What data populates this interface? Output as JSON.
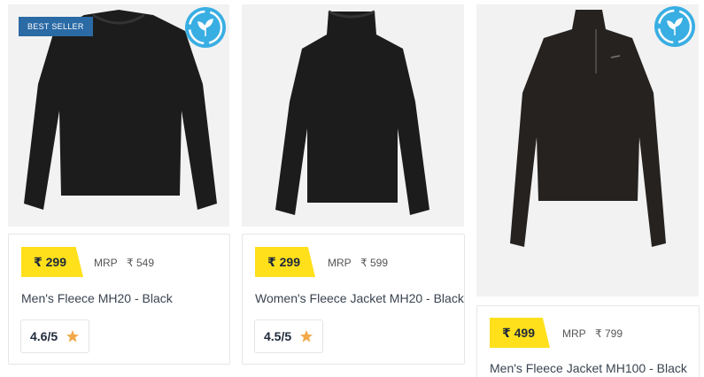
{
  "products": [
    {
      "badge": "BEST SELLER",
      "price": "₹ 299",
      "mrp_label": "MRP",
      "mrp_value": "₹ 549",
      "title": "Men's Fleece MH20 - Black",
      "rating": "4.6/5",
      "icons": [
        "eco-design-icon",
        "star-icon"
      ]
    },
    {
      "price": "₹ 299",
      "mrp_label": "MRP",
      "mrp_value": "₹ 599",
      "title": "Women's Fleece Jacket MH20 - Black",
      "rating": "4.5/5",
      "icons": [
        "star-icon"
      ]
    },
    {
      "price": "₹ 499",
      "mrp_label": "MRP",
      "mrp_value": "₹ 799",
      "title": "Men's Fleece Jacket MH100 - Black",
      "icons": [
        "eco-design-icon"
      ]
    }
  ],
  "colors": {
    "price_tag": "#ffe01b",
    "badge": "#2a6aa5",
    "eco_icon": "#39aee3",
    "star": "#f2a94a"
  }
}
